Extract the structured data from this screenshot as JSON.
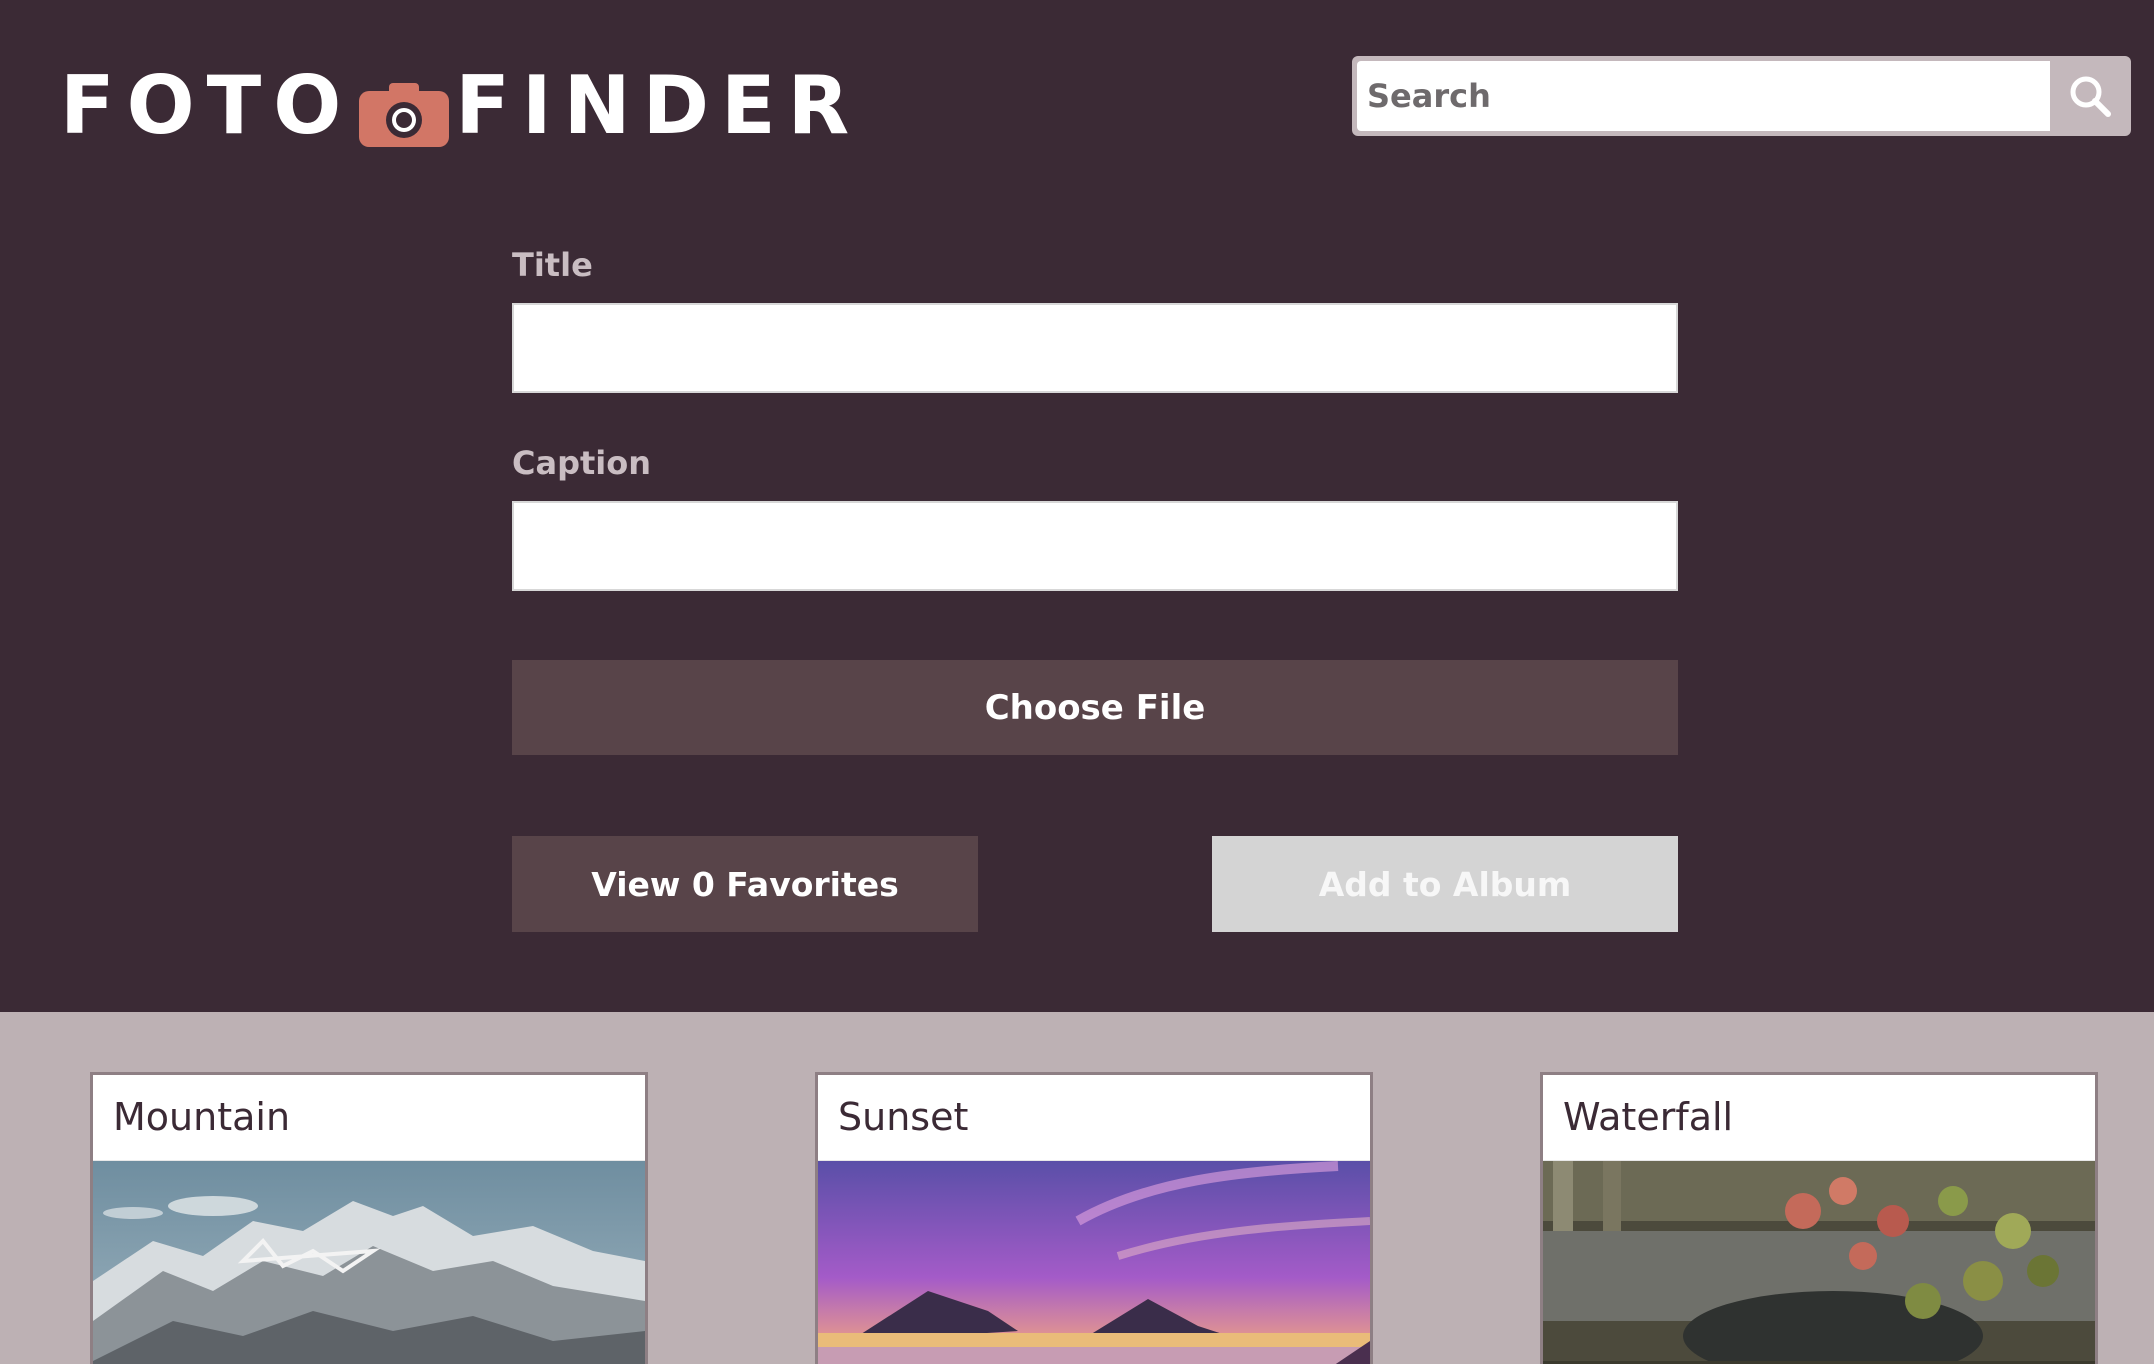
{
  "header": {
    "logo_left": "FOTO",
    "logo_right": "FINDER",
    "search_placeholder": "Search",
    "search_value": ""
  },
  "form": {
    "title_label": "Title",
    "title_value": "",
    "caption_label": "Caption",
    "caption_value": "",
    "choose_file_label": "Choose File",
    "view_favorites_label": "View 0 Favorites",
    "add_to_album_label": "Add to Album"
  },
  "gallery": {
    "cards": [
      {
        "title": "Mountain",
        "image": "mountain"
      },
      {
        "title": "Sunset",
        "image": "sunset"
      },
      {
        "title": "Waterfall",
        "image": "waterfall"
      }
    ]
  },
  "colors": {
    "header_bg": "#3b2a35",
    "accent": "#d27666",
    "button_bg": "#584449",
    "disabled_button_bg": "#d4d4d4",
    "gallery_bg": "#bdb1b4",
    "label": "#c9bdc2"
  },
  "icons": {
    "logo_camera": "camera-icon",
    "search": "magnifier-icon"
  }
}
